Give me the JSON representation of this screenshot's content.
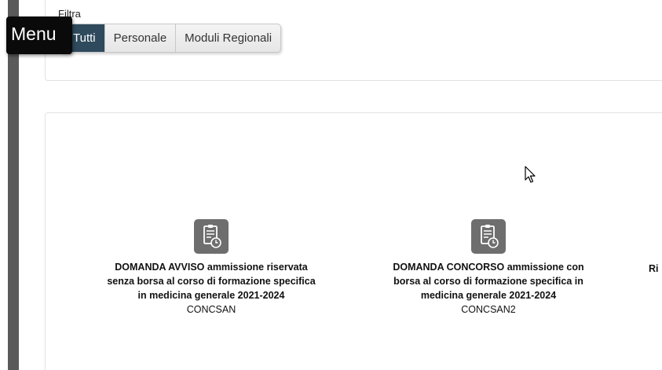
{
  "menu": {
    "label": "Menu"
  },
  "filter": {
    "label": "Filtra",
    "options": [
      "Tutti",
      "Personale",
      "Moduli Regionali"
    ],
    "selected": "Tutti"
  },
  "cards": [
    {
      "title_lines": [
        "DOMANDA AVVISO ammissione riservata",
        "senza borsa al corso di formazione specifica",
        "in medicina generale 2021-2024"
      ],
      "code": "CONCSAN",
      "icon": "form-clock-icon"
    },
    {
      "title_lines": [
        "DOMANDA CONCORSO ammissione con",
        "borsa al corso di formazione specifica in",
        "medicina generale 2021-2024"
      ],
      "code": "CONCSAN2",
      "icon": "form-clock-icon"
    }
  ],
  "third_card_partial": "Ri",
  "colors": {
    "selected_tab": "#2f4a5c",
    "icon_bg": "#6e6e6e",
    "menu_bg": "#0a0a0a"
  }
}
